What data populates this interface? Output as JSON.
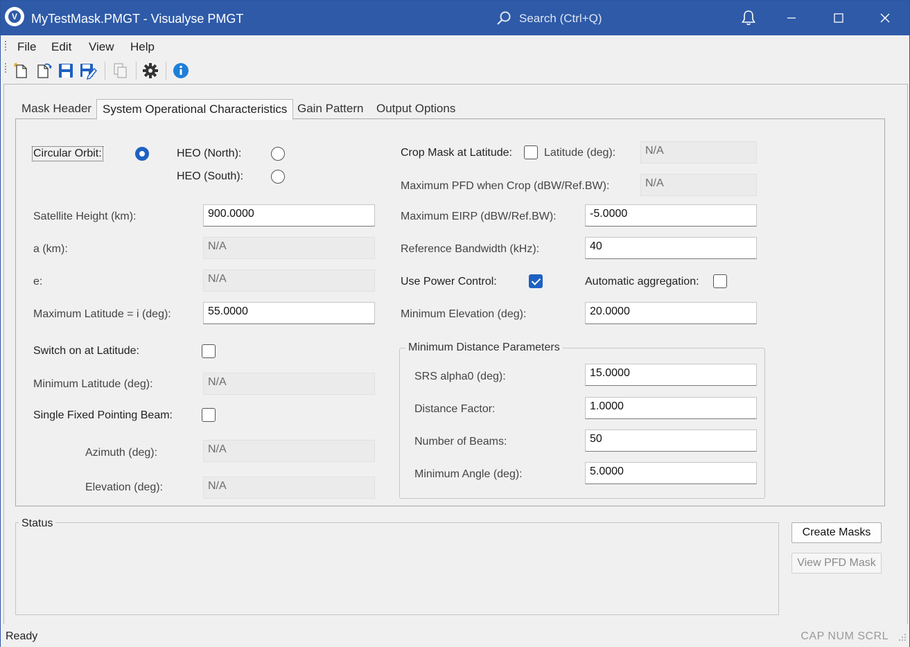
{
  "window": {
    "title": "MyTestMask.PMGT - Visualyse PMGT",
    "search_placeholder": "Search (Ctrl+Q)",
    "accent": "#2e5aa8"
  },
  "menu": [
    "File",
    "Edit",
    "View",
    "Help"
  ],
  "toolbar_icons": [
    "new-file-icon",
    "open-file-icon",
    "save-icon",
    "save-as-icon",
    "copy-icon",
    "settings-gear-icon",
    "info-icon"
  ],
  "tabs": [
    "Mask Header",
    "System Operational Characteristics",
    "Gain Pattern",
    "Output Options"
  ],
  "active_tab": 1,
  "orbit": {
    "circular_label": "Circular Orbit:",
    "heo_north_label": "HEO (North):",
    "heo_south_label": "HEO (South):",
    "selected": "circular"
  },
  "left_fields": {
    "sat_height_label": "Satellite Height (km):",
    "sat_height_value": "900.0000",
    "a_label": "a (km):",
    "a_value": "N/A",
    "e_label": "e:",
    "e_value": "N/A",
    "max_lat_label": "Maximum Latitude = i (deg):",
    "max_lat_value": "55.0000",
    "switch_label": "Switch on at Latitude:",
    "switch_checked": false,
    "min_lat_label": "Minimum Latitude (deg):",
    "min_lat_value": "N/A",
    "single_beam_label": "Single Fixed Pointing Beam:",
    "single_beam_checked": false,
    "azimuth_label": "Azimuth (deg):",
    "azimuth_value": "N/A",
    "elevation_label": "Elevation (deg):",
    "elevation_value": "N/A"
  },
  "right_fields": {
    "crop_label": "Crop Mask at Latitude:",
    "crop_checked": false,
    "crop_lat_label": "Latitude (deg):",
    "crop_lat_value": "N/A",
    "max_pfd_label": "Maximum PFD when Crop (dBW/Ref.BW):",
    "max_pfd_value": "N/A",
    "max_eirp_label": "Maximum EIRP (dBW/Ref.BW):",
    "max_eirp_value": "-5.0000",
    "ref_bw_label": "Reference Bandwidth (kHz):",
    "ref_bw_value": "40",
    "power_control_label": "Use Power Control:",
    "power_control_checked": true,
    "auto_agg_label": "Automatic aggregation:",
    "auto_agg_checked": false,
    "min_elev_label": "Minimum Elevation (deg):",
    "min_elev_value": "20.0000"
  },
  "min_distance": {
    "title": "Minimum Distance Parameters",
    "srs_label": "SRS alpha0 (deg):",
    "srs_value": "15.0000",
    "dist_factor_label": "Distance Factor:",
    "dist_factor_value": "1.0000",
    "num_beams_label": "Number of Beams:",
    "num_beams_value": "50",
    "min_angle_label": "Minimum Angle (deg):",
    "min_angle_value": "5.0000"
  },
  "status": {
    "title": "Status",
    "create_masks": "Create Masks",
    "view_pfd_mask": "View PFD Mask"
  },
  "statusbar": {
    "text": "Ready",
    "indicators": "CAP NUM SCRL"
  }
}
